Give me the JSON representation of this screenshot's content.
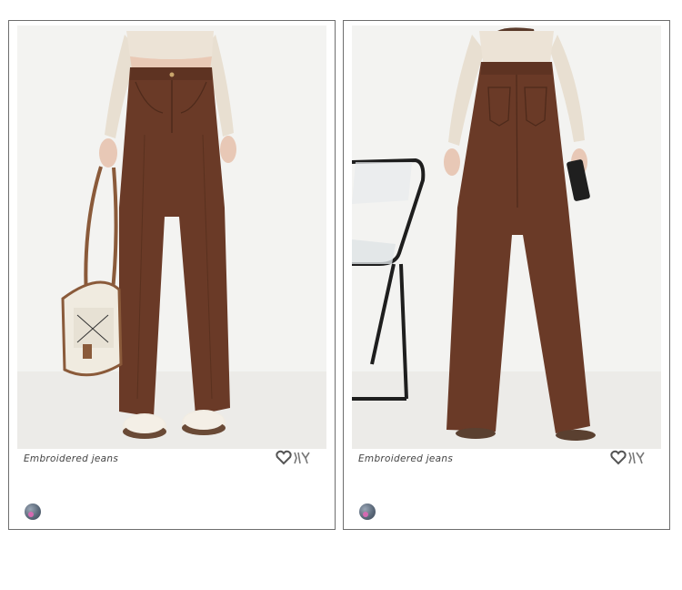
{
  "cards": [
    {
      "view": "front",
      "caption": "Embroidered jeans",
      "brand_icon": "heart-logo-icon",
      "avatar_icon": "user-avatar-icon"
    },
    {
      "view": "back",
      "caption": "Embroidered jeans",
      "brand_icon": "heart-logo-icon",
      "avatar_icon": "user-avatar-icon"
    }
  ],
  "colors": {
    "jeans_brown": "#6a3a27",
    "top_cream": "#ece3d6",
    "background": "#f3f3f1",
    "card_border": "#6e6e6e"
  }
}
